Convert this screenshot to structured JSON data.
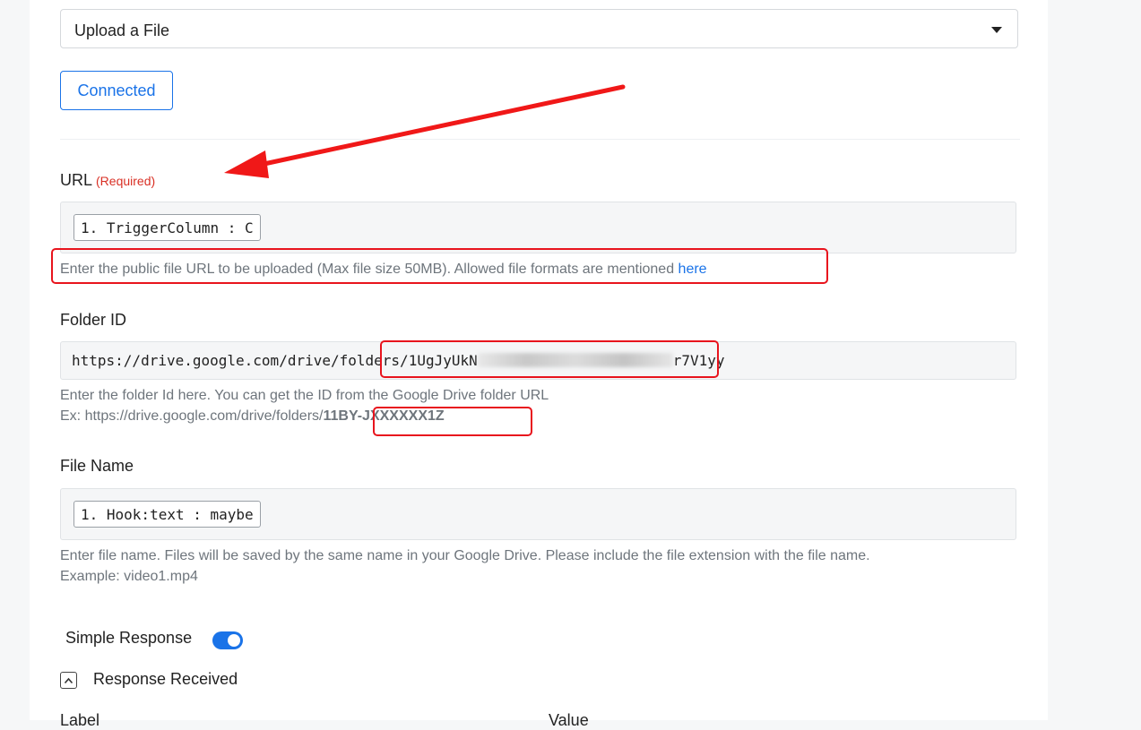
{
  "action_select": {
    "value": "Upload a File"
  },
  "connection": {
    "button_label": "Connected"
  },
  "url_field": {
    "label": "URL",
    "required_text": "(Required)",
    "token": "1. TriggerColumn : C",
    "help_text": "Enter the public file URL to be uploaded (Max file size 50MB). Allowed file formats are mentioned",
    "help_link": "here"
  },
  "folder_field": {
    "label": "Folder ID",
    "value_prefix": "https://drive.google.com/drive/folders/",
    "value_start": "1UgJyUkN",
    "value_end": "r7V1yy",
    "help_line1": "Enter the folder Id here. You can get the ID from the Google Drive folder URL",
    "help_line2_prefix": "Ex: https://drive.google.com/drive/folders/",
    "help_line2_bold": "11BY-JXXXXXX1Z"
  },
  "file_name_field": {
    "label": "File Name",
    "token": "1. Hook:text : maybe",
    "help_line1": "Enter file name. Files will be saved by the same name in your Google Drive. Please include the file extension with the file name.",
    "help_line2": "Example: video1.mp4"
  },
  "simple_response": {
    "label": "Simple Response",
    "enabled": true
  },
  "response_section": {
    "title": "Response Received",
    "col_label": "Label",
    "col_value": "Value"
  },
  "colors": {
    "accent": "#1a73e8",
    "highlight": "#e8141d",
    "required": "#d93025"
  }
}
